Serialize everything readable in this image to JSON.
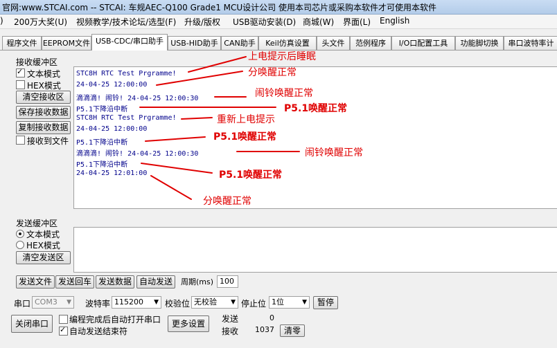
{
  "window": {
    "title": "官网:www.STCAI.com  -- STCAI: 车规AEC-Q100 Grade1 MCU设计公司 使用本司芯片或采购本软件才可使用本软件"
  },
  "menu": [
    {
      "label": ")"
    },
    {
      "label": "200万大奖(U)"
    },
    {
      "label": "视频教学/技术论坛/选型(F)"
    },
    {
      "label": "升级/版权"
    },
    {
      "label": "USB驱动安装(D)"
    },
    {
      "label": "商城(W)"
    },
    {
      "label": "界面(L)"
    },
    {
      "label": "English"
    }
  ],
  "tabs": [
    {
      "label": "程序文件"
    },
    {
      "label": "EEPROM文件"
    },
    {
      "label": "USB-CDC/串口助手"
    },
    {
      "label": "USB-HID助手"
    },
    {
      "label": "CAN助手"
    },
    {
      "label": "Keil仿真设置"
    },
    {
      "label": "头文件"
    },
    {
      "label": "范例程序"
    },
    {
      "label": "I/O口配置工具"
    },
    {
      "label": "功能脚切换"
    },
    {
      "label": "串口波特率计"
    }
  ],
  "receive": {
    "group_label": "接收缓冲区",
    "text_mode": "文本模式",
    "hex_mode": "HEX模式",
    "clear_button": "清空接收区",
    "save_button": "保存接收数据",
    "copy_button": "复制接收数据",
    "to_file": "接收到文件",
    "lines": [
      "STC8H RTC Test Prgramme!",
      "24-04-25 12:00:00",
      "滴滴滴! 闹铃!  24-04-25 12:00:30",
      "P5.1下降沿中断",
      "STC8H RTC Test Prgramme!",
      "24-04-25 12:00:00",
      "P5.1下降沿中断",
      "滴滴滴! 闹铃!  24-04-25 12:00:30",
      "P5.1下降沿中断",
      "24-04-25 12:01:00"
    ],
    "annotations": [
      "上电提示后睡眠",
      "分唤醒正常",
      "闹铃唤醒正常",
      "P5.1唤醒正常",
      "重新上电提示",
      "P5.1唤醒正常",
      "闹铃唤醒正常",
      "P5.1唤醒正常",
      "分唤醒正常"
    ],
    "annotation_color": "#e00000"
  },
  "send": {
    "group_label": "发送缓冲区",
    "text_mode": "文本模式",
    "hex_mode": "HEX模式",
    "clear_button": "清空发送区",
    "buttons": [
      "发送文件",
      "发送回车",
      "发送数据",
      "自动发送"
    ],
    "period_label": "周期(ms)",
    "period_value": "100"
  },
  "bottom": {
    "port_label": "串口",
    "port_value": "COM3",
    "baud_label": "波特率",
    "baud_value": "115200",
    "parity_label": "校验位",
    "parity_value": "无校验",
    "stop_label": "停止位",
    "stop_value": "1位",
    "pause_button": "暂停",
    "close_port_button": "关闭串口",
    "auto_open_label": "编程完成后自动打开串口",
    "auto_end_label": "自动发送结束符",
    "more_settings_button": "更多设置",
    "send_label": "发送",
    "send_count": "0",
    "recv_label": "接收",
    "recv_count": "1037",
    "clear_count_button": "清零"
  }
}
